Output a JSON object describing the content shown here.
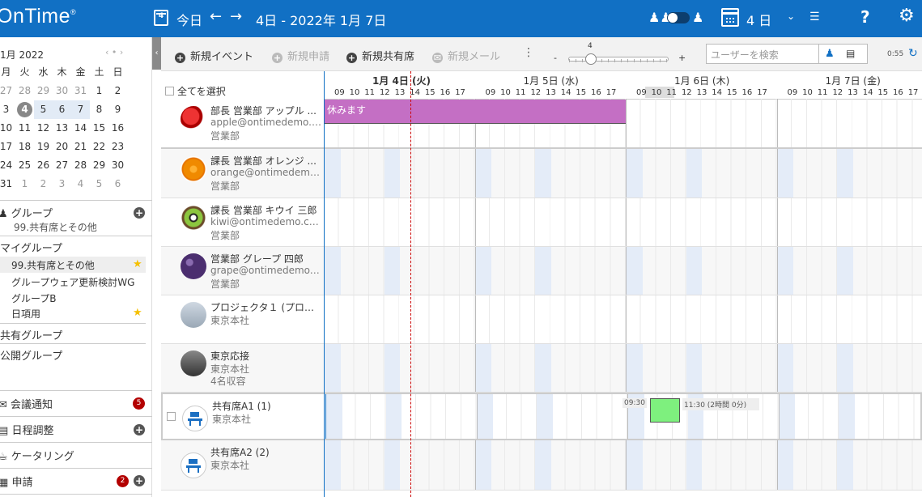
{
  "header": {
    "logo": "OnTime",
    "logo_mark": "®",
    "calendar_icon_day": "4",
    "today_label": "今日",
    "prev": "←",
    "next": "→",
    "date_range": "4日 - 2022年 1月 7日",
    "days_label": "4 日",
    "help": "?",
    "colors": {
      "bar": "#1170c4"
    }
  },
  "mini_calendar": {
    "title": "1月 2022",
    "nav": "‹ • ›",
    "weekdays": [
      "月",
      "火",
      "水",
      "木",
      "金",
      "土",
      "日"
    ],
    "weeks": [
      [
        [
          "27",
          "dim"
        ],
        [
          "28",
          "dim"
        ],
        [
          "29",
          "dim"
        ],
        [
          "30",
          "dim"
        ],
        [
          "31",
          "dim"
        ],
        [
          "1",
          ""
        ],
        [
          "2",
          ""
        ]
      ],
      [
        [
          "3",
          ""
        ],
        [
          "4",
          "today"
        ],
        [
          "5",
          "sel"
        ],
        [
          "6",
          "sel"
        ],
        [
          "7",
          "sel"
        ],
        [
          "8",
          ""
        ],
        [
          "9",
          ""
        ]
      ],
      [
        [
          "10",
          ""
        ],
        [
          "11",
          ""
        ],
        [
          "12",
          ""
        ],
        [
          "13",
          ""
        ],
        [
          "14",
          ""
        ],
        [
          "15",
          ""
        ],
        [
          "16",
          ""
        ]
      ],
      [
        [
          "17",
          ""
        ],
        [
          "18",
          ""
        ],
        [
          "19",
          ""
        ],
        [
          "20",
          ""
        ],
        [
          "21",
          ""
        ],
        [
          "22",
          ""
        ],
        [
          "23",
          ""
        ]
      ],
      [
        [
          "24",
          ""
        ],
        [
          "25",
          ""
        ],
        [
          "26",
          ""
        ],
        [
          "27",
          ""
        ],
        [
          "28",
          ""
        ],
        [
          "29",
          ""
        ],
        [
          "30",
          ""
        ]
      ],
      [
        [
          "31",
          ""
        ],
        [
          "1",
          "dim"
        ],
        [
          "2",
          "dim"
        ],
        [
          "3",
          "dim"
        ],
        [
          "4",
          "dim"
        ],
        [
          "5",
          "dim"
        ],
        [
          "6",
          "dim"
        ]
      ]
    ]
  },
  "sidebar": {
    "group_heading": "グループ",
    "group_current": "99.共有席とその他",
    "my_groups_heading": "マイグループ",
    "my_groups": [
      "99.共有席とその他",
      "グループウェア更新検討WG",
      "グループB",
      "日項用"
    ],
    "shared_groups": "共有グループ",
    "public_groups": "公開グループ",
    "meeting_notice": "会議通知",
    "meeting_notice_count": "5",
    "schedule_adjust": "日程調整",
    "catering": "ケータリング",
    "request": "申請",
    "request_count": "2"
  },
  "toolbar": {
    "new_event": "新規イベント",
    "new_request": "新規申請",
    "new_shared_seat": "新規共有席",
    "new_mail": "新規メール",
    "zoom_value": "4",
    "zoom_minus": "-",
    "zoom_plus": "+",
    "search_placeholder": "ユーザーを検索",
    "time": "0:55"
  },
  "schedule": {
    "select_all": "全てを選択",
    "days": [
      {
        "label": "1月 4日 (火)",
        "bold": true
      },
      {
        "label": "1月 5日 (水)",
        "bold": false
      },
      {
        "label": "1月 6日 (木)",
        "bold": false
      },
      {
        "label": "1月 7日 (金)",
        "bold": false
      }
    ],
    "hours": [
      "09",
      "10",
      "11",
      "12",
      "13",
      "14",
      "15",
      "16",
      "17"
    ],
    "resources": [
      {
        "name": "部長 営業部 アップル ...",
        "email": "apple@ontimedemo.c...",
        "dept": "営業部",
        "avatar": "apple"
      },
      {
        "name": "課長 営業部 オレンジ ...",
        "email": "orange@ontimedemo....",
        "dept": "営業部",
        "avatar": "orange"
      },
      {
        "name": "課長 営業部 キウイ 三郎",
        "email": "kiwi@ontimedemo.com",
        "dept": "営業部",
        "avatar": "kiwi"
      },
      {
        "name": "営業部 グレープ 四郎",
        "email": "grape@ontimedemo.c...",
        "dept": "営業部",
        "avatar": "grape"
      },
      {
        "name": "プロジェクタ１ (プロジ...",
        "email": "東京本社",
        "dept": "",
        "avatar": "projector"
      },
      {
        "name": "東京応接",
        "email": "東京本社",
        "dept": "4名収容",
        "avatar": "room"
      },
      {
        "name": "共有席A1 (1)",
        "email": "東京本社",
        "dept": "",
        "avatar": "desk"
      },
      {
        "name": "共有席A2 (2)",
        "email": "東京本社",
        "dept": "",
        "avatar": "desk"
      }
    ],
    "events": {
      "vacation": "休みます",
      "seat_start": "09:30",
      "seat_end": "11:30 (2時間 0分)"
    },
    "colors": {
      "vacation": "#c46fc4",
      "seat_booking": "#7ef07e",
      "highlight_col": "#e4ecf8"
    }
  }
}
